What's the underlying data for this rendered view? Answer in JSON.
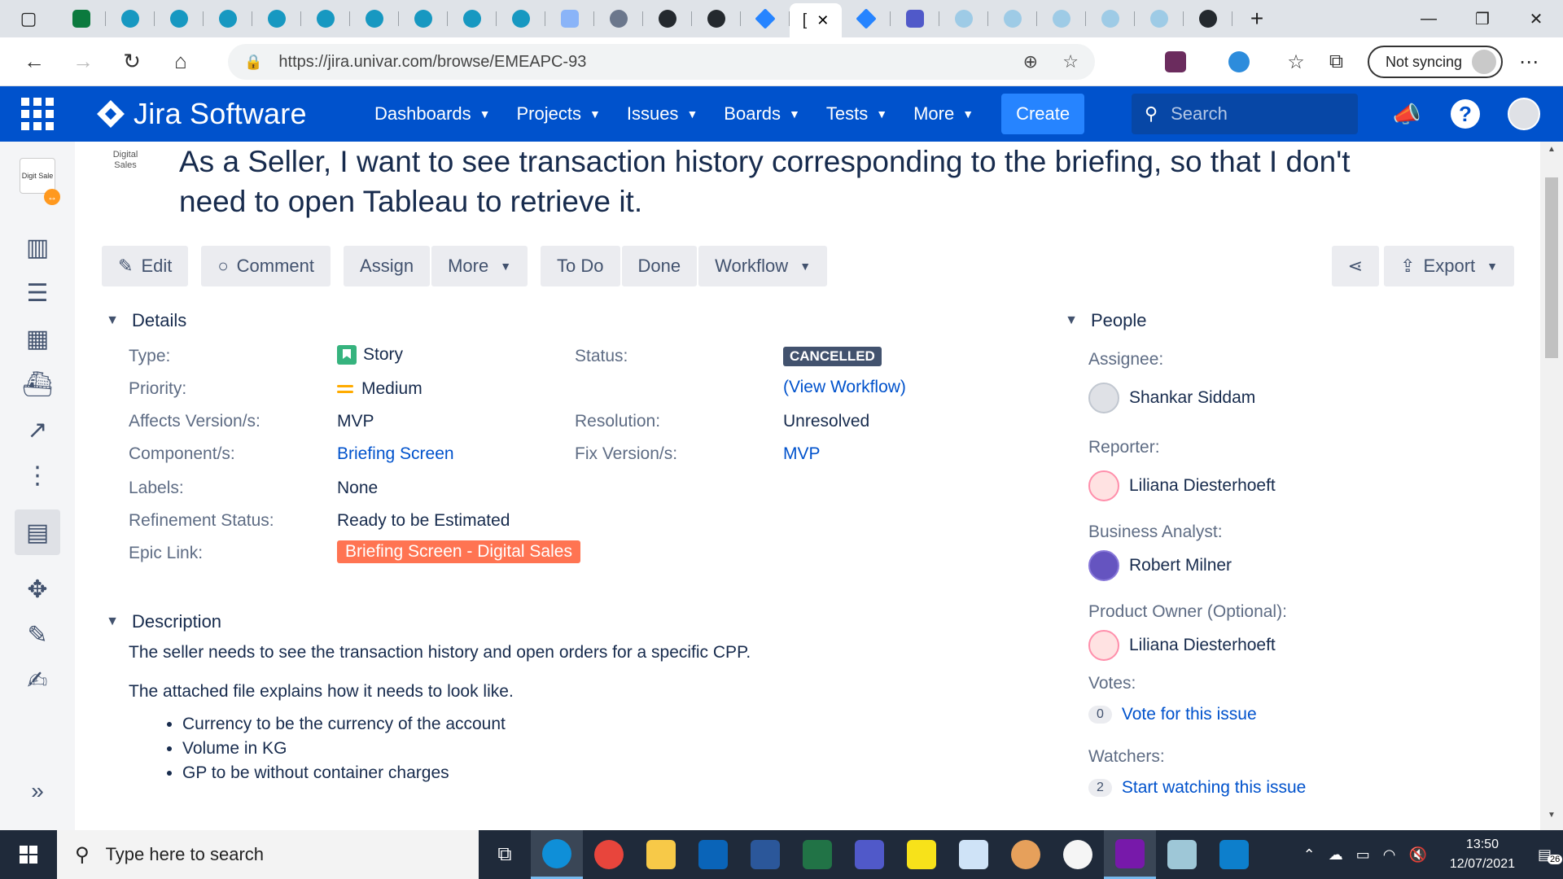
{
  "browser": {
    "url": "https://jira.univar.com/browse/EMEAPC-93",
    "sync_label": "Not syncing",
    "active_tab_char": "[",
    "tab_close": "✕",
    "new_tab": "+"
  },
  "jira": {
    "logo_text": "Jira Software",
    "nav": [
      "Dashboards",
      "Projects",
      "Issues",
      "Boards",
      "Tests",
      "More"
    ],
    "create_label": "Create",
    "search_placeholder": "Search"
  },
  "project_avatar_text": "Digital Sales",
  "sidebar_avatar_text": "Digit Sale",
  "issue": {
    "title": "As a Seller, I want to see transaction history corresponding to the briefing, so that I don't need to open Tableau to retrieve it.",
    "toolbar": {
      "edit": "Edit",
      "comment": "Comment",
      "assign": "Assign",
      "more": "More",
      "todo": "To Do",
      "done": "Done",
      "workflow": "Workflow",
      "export": "Export"
    },
    "details_title": "Details",
    "details": {
      "type_label": "Type:",
      "type_value": "Story",
      "priority_label": "Priority:",
      "priority_value": "Medium",
      "affects_label": "Affects Version/s:",
      "affects_value": "MVP",
      "component_label": "Component/s:",
      "component_value": "Briefing Screen",
      "labels_label": "Labels:",
      "labels_value": "None",
      "refinement_label": "Refinement Status:",
      "refinement_value": "Ready to be Estimated",
      "epic_label": "Epic Link:",
      "epic_value": "Briefing Screen - Digital Sales",
      "status_label": "Status:",
      "status_value": "CANCELLED",
      "view_workflow": "(View Workflow)",
      "resolution_label": "Resolution:",
      "resolution_value": "Unresolved",
      "fix_label": "Fix Version/s:",
      "fix_value": "MVP"
    },
    "description_title": "Description",
    "description": {
      "p1": "The seller needs to see the transaction history and open orders for a specific CPP.",
      "p2": "The attached file explains how it needs to look like.",
      "bullets": [
        "Currency to be the currency of the account",
        "Volume in KG",
        "GP to be without container charges"
      ]
    },
    "people_title": "People",
    "people": {
      "assignee_label": "Assignee:",
      "assignee": "Shankar Siddam",
      "reporter_label": "Reporter:",
      "reporter": "Liliana Diesterhoeft",
      "ba_label": "Business Analyst:",
      "ba": "Robert Milner",
      "po_label": "Product Owner (Optional):",
      "po": "Liliana Diesterhoeft",
      "votes_label": "Votes:",
      "votes_count": "0",
      "vote_link": "Vote for this issue",
      "watchers_label": "Watchers:",
      "watchers_count": "2",
      "watch_link": "Start watching this issue"
    }
  },
  "taskbar": {
    "search_placeholder": "Type here to search",
    "time": "13:50",
    "date": "12/07/2021",
    "notif_count": "26"
  }
}
